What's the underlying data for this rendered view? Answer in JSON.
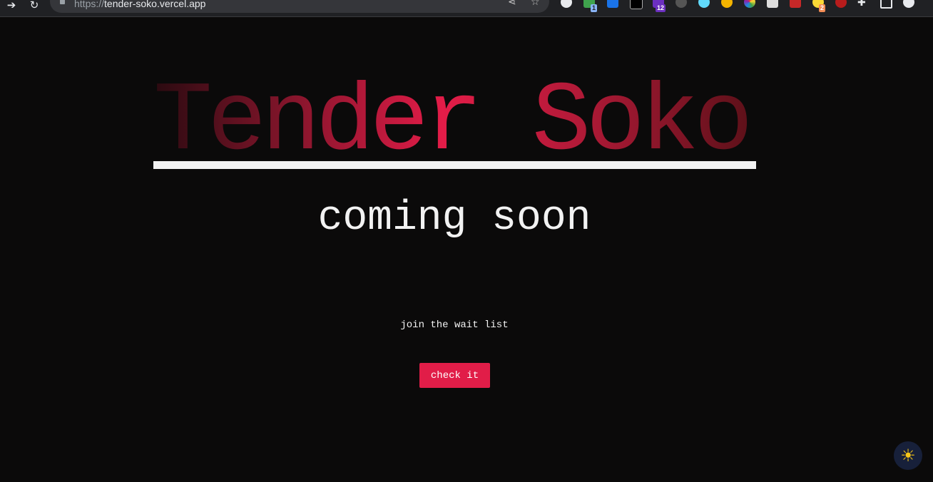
{
  "browser": {
    "url_scheme": "https://",
    "url_host": "tender-soko.vercel.app",
    "extension_badges": [
      "1",
      "12",
      "2"
    ]
  },
  "page": {
    "title": "Tender Soko",
    "subtitle": "coming soon",
    "waitlist_text": "join the wait list",
    "cta_label": "check it"
  },
  "theme": {
    "background": "#0b0a0a",
    "accent": "#e11d48",
    "text": "#f2f2f2",
    "toggle_icon": "sun-icon"
  }
}
